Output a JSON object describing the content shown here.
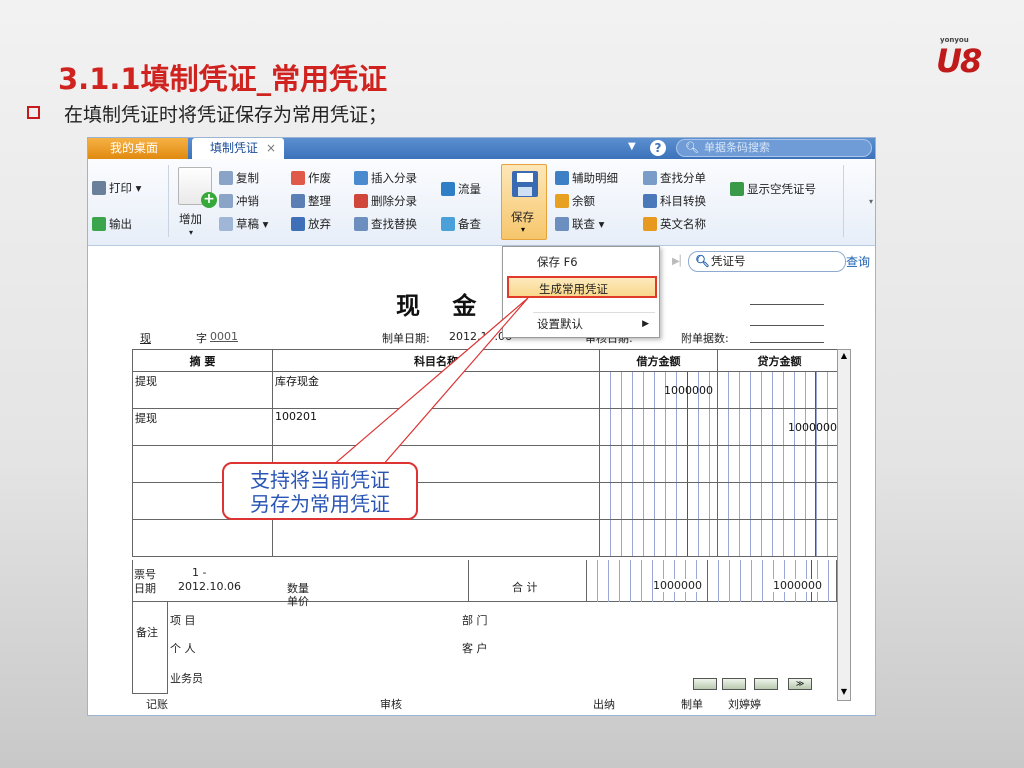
{
  "slide": {
    "title": "3.1.1填制凭证_常用凭证",
    "bullet": "在填制凭证时将凭证保存为常用凭证；",
    "logo_small": "yonyou",
    "logo_main": "U8"
  },
  "tabs": {
    "desk": "我的桌面",
    "voucher": "填制凭证",
    "close": "×",
    "search_placeholder": "单据条码搜索"
  },
  "toolbar": {
    "print": "打印",
    "output": "输出",
    "add": "增加",
    "copy": "复制",
    "reverse": "冲销",
    "draft": "草稿",
    "void": "作废",
    "sort": "整理",
    "abandon": "放弃",
    "insert_entry": "插入分录",
    "delete_entry": "删除分录",
    "find_replace": "查找替换",
    "flow": "流量",
    "backup": "备查",
    "save": "保存",
    "aux_detail": "辅助明细",
    "balance": "余额",
    "link_query": "联查",
    "find_entry": "查找分单",
    "subject_convert": "科目转换",
    "english_name": "英文名称",
    "show_empty_no": "显示空凭证号"
  },
  "save_menu": {
    "save_f6": "保存 F6",
    "generate_common": "生成常用凭证",
    "set_default": "设置默认"
  },
  "find": {
    "field": "凭证号",
    "query": "查询"
  },
  "voucher": {
    "title": "现 金 凭",
    "type_label": "现",
    "zi": "字",
    "number": "0001",
    "date_label": "制单日期:",
    "date": "2012.10.06",
    "audit_date_label": "审核日期:",
    "attach_label": "附单据数:",
    "headers": [
      "摘 要",
      "科目名称",
      "借方金额",
      "贷方金额"
    ],
    "rows": [
      {
        "summary": "提现",
        "subject": "库存现金",
        "debit": "1000000",
        "credit": ""
      },
      {
        "summary": "提现",
        "subject": "100201",
        "debit": "",
        "credit": "1000000"
      },
      {
        "summary": "",
        "subject": "",
        "debit": "",
        "credit": ""
      },
      {
        "summary": "",
        "subject": "",
        "debit": "",
        "credit": ""
      },
      {
        "summary": "",
        "subject": "",
        "debit": "",
        "credit": ""
      }
    ],
    "ticket_label": "票号",
    "ticket_value": "1 -",
    "date2_label": "日期",
    "date2_value": "2012.10.06",
    "qty_label": "数量",
    "price_label": "单价",
    "total_label": "合 计",
    "total_debit": "1000000",
    "total_credit": "1000000",
    "remark_label": "备注",
    "project_label": "项 目",
    "dept_label": "部 门",
    "person_label": "个 人",
    "customer_label": "客 户",
    "salesman_label": "业务员",
    "footer_book": "记账",
    "footer_audit": "审核",
    "footer_cashier": "出纳",
    "footer_maker_label": "制单",
    "footer_maker": "刘婷婷"
  },
  "callout": {
    "line1": "支持将当前凭证",
    "line2": "另存为常用凭证"
  },
  "colors": {
    "title_red": "#d0221e",
    "tab_orange": "#f0a030",
    "tab_blue": "#3c72ba",
    "highlight_border": "#e23a2a",
    "callout_text": "#2a55b5"
  }
}
